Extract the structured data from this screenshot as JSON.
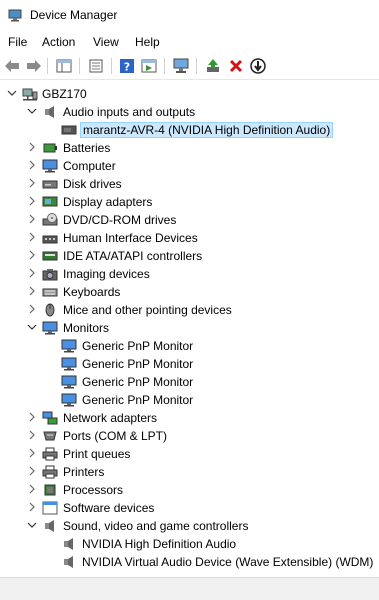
{
  "window": {
    "title": "Device Manager"
  },
  "menu": {
    "items": [
      "File",
      "Action",
      "View",
      "Help"
    ]
  },
  "toolbar": {
    "buttons": [
      "back-arrow-icon",
      "forward-arrow-icon",
      "show-hide-tree-icon",
      "properties-icon",
      "help-icon",
      "action-pane-icon",
      "scan-hardware-icon",
      "update-driver-icon",
      "uninstall-icon",
      "disable-device-icon"
    ]
  },
  "tree": {
    "root": "GBZ170",
    "audio_inputs": {
      "label": "Audio inputs and outputs",
      "children": [
        "marantz-AVR-4 (NVIDIA High Definition Audio)"
      ]
    },
    "categories_a": [
      "Batteries",
      "Computer",
      "Disk drives",
      "Display adapters",
      "DVD/CD-ROM drives",
      "Human Interface Devices",
      "IDE ATA/ATAPI controllers",
      "Imaging devices",
      "Keyboards",
      "Mice and other pointing devices"
    ],
    "monitors": {
      "label": "Monitors",
      "children": [
        "Generic PnP Monitor",
        "Generic PnP Monitor",
        "Generic PnP Monitor",
        "Generic PnP Monitor"
      ]
    },
    "categories_b": [
      "Network adapters",
      "Ports (COM & LPT)",
      "Print queues",
      "Printers",
      "Processors",
      "Software devices"
    ],
    "sound": {
      "label": "Sound, video and game controllers",
      "children": [
        "NVIDIA High Definition Audio",
        "NVIDIA Virtual Audio Device (Wave Extensible) (WDM)"
      ]
    }
  }
}
